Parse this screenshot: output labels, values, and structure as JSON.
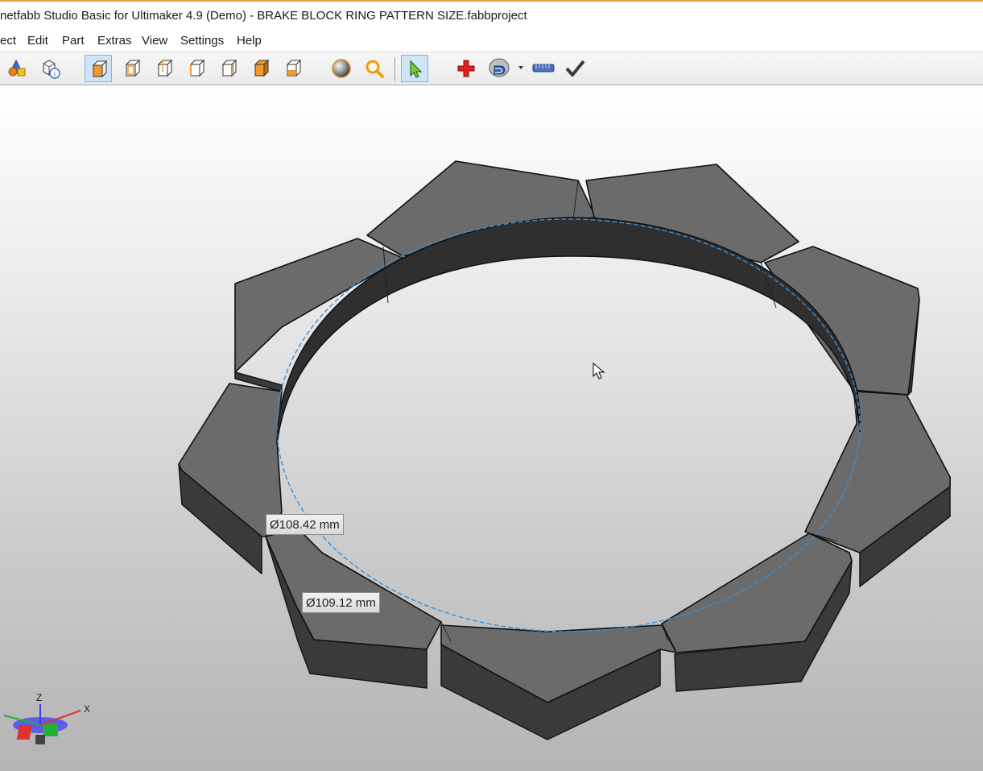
{
  "window": {
    "title": "netfabb Studio Basic for Ultimaker 4.9 (Demo) - BRAKE BLOCK RING PATTERN SIZE.fabbproject"
  },
  "menu": {
    "items": [
      "ect",
      "Edit",
      "Part",
      "Extras",
      "View",
      "Settings",
      "Help"
    ]
  },
  "toolbar": {
    "buttons": [
      {
        "name": "add-part-icon",
        "active": false
      },
      {
        "name": "part-info-icon",
        "active": false
      },
      {
        "name": "view-default-cube-icon",
        "active": true
      },
      {
        "name": "view-front-cube-icon",
        "active": false
      },
      {
        "name": "view-back-cube-icon",
        "active": false
      },
      {
        "name": "view-left-cube-icon",
        "active": false
      },
      {
        "name": "view-right-cube-icon",
        "active": false
      },
      {
        "name": "view-top-cube-icon",
        "active": false
      },
      {
        "name": "view-bottom-cube-icon",
        "active": false
      },
      {
        "name": "sphere-shading-icon",
        "active": false
      },
      {
        "name": "zoom-magnifier-icon",
        "active": false
      },
      {
        "name": "select-arrow-icon",
        "active": true
      },
      {
        "name": "repair-cross-icon",
        "active": false
      },
      {
        "name": "cut-disc-icon",
        "active": false
      },
      {
        "name": "measure-ruler-icon",
        "active": false
      },
      {
        "name": "apply-check-icon",
        "active": false
      }
    ]
  },
  "viewport": {
    "measurements": {
      "outer_diameter": "Ø108.42 mm",
      "inner_diameter": "Ø109.12 mm"
    },
    "axes": {
      "z": "Z",
      "x": "X"
    },
    "colors": {
      "model_top": "#6c6c6c",
      "model_side": "#3c3c3c",
      "measure_line": "#3a8fd6"
    }
  }
}
